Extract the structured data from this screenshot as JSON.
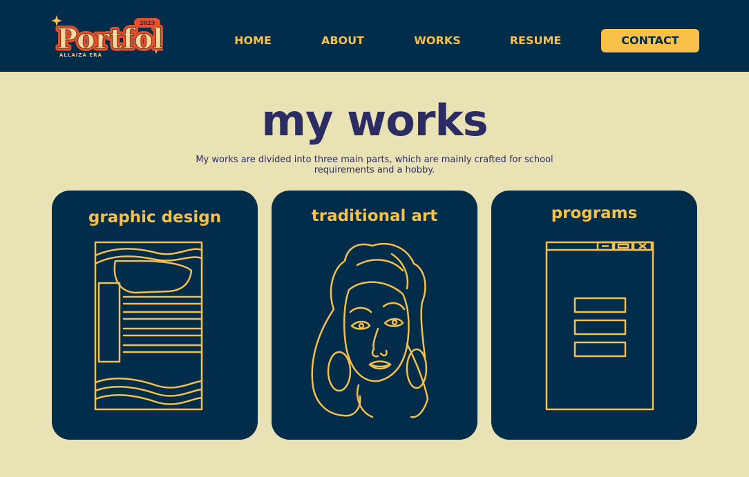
{
  "header": {
    "logo": {
      "text": "Portfolio",
      "year": "2023",
      "subtitle": "ALLAIZA ERA"
    },
    "nav": [
      {
        "label": "HOME"
      },
      {
        "label": "ABOUT"
      },
      {
        "label": "WORKS"
      },
      {
        "label": "RESUME"
      }
    ],
    "contact_label": "CONTACT"
  },
  "main": {
    "title": "my works",
    "intro": "My works are divided into three main parts, which are mainly crafted for school requirements and a hobby.",
    "cards": [
      {
        "title": "graphic design",
        "icon": "poster-layout-icon"
      },
      {
        "title": "traditional art",
        "icon": "face-line-art-icon"
      },
      {
        "title": "programs",
        "icon": "app-window-icon"
      }
    ]
  },
  "colors": {
    "navy": "#012d4b",
    "cream": "#e9e2b5",
    "gold": "#f6c04a",
    "title_ink": "#2b2c63"
  }
}
